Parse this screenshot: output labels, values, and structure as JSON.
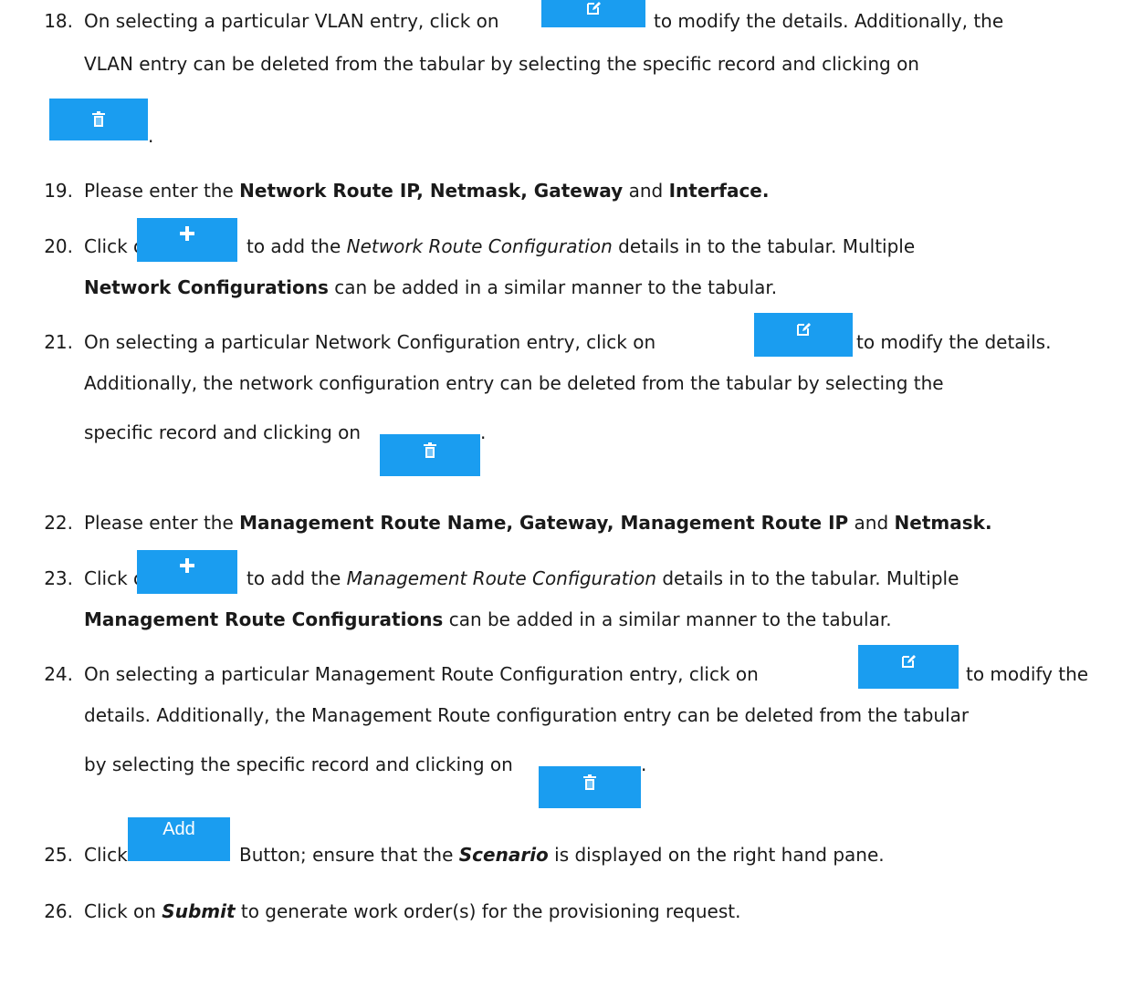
{
  "steps": [
    {
      "number": "18.",
      "t1": "On selecting a particular VLAN entry, click on",
      "t2": "to modify the details. Additionally, the",
      "t3": "VLAN entry can be deleted from the tabular by selecting the specific record and clicking on",
      "t4": "."
    },
    {
      "number": "19.",
      "t1": "Please enter the",
      "b1": "Network Route IP, Netmask, Gateway",
      "t2": "and",
      "b2": "Interface."
    },
    {
      "number": "20.",
      "t1": "Click on",
      "t2": "to add the",
      "i1": "Network Route Configuration",
      "t3": "details in to the tabular. Multiple",
      "b1": "Network Configurations",
      "t4": "can be added in a similar manner to the tabular."
    },
    {
      "number": "21.",
      "t1": "On selecting a particular Network Configuration entry, click on",
      "t2": "to modify the details.",
      "t3": "Additionally, the network configuration entry can be deleted from the tabular by selecting the",
      "t4": "specific record and clicking on",
      "t5": "."
    },
    {
      "number": "22.",
      "t1": "Please enter the",
      "b1": "Management Route Name, Gateway, Management Route IP",
      "t2": "and",
      "b2": "Netmask."
    },
    {
      "number": "23.",
      "t1": "Click on",
      "t2": "to add the",
      "i1": "Management Route Configuration",
      "t3": "details in to the tabular. Multiple",
      "b1": "Management Route Configurations",
      "t4": "can be added in a similar manner to the tabular."
    },
    {
      "number": "24.",
      "t1": "On selecting a particular Management Route Configuration entry, click on",
      "t2": "to modify the",
      "t3": "details. Additionally, the Management Route configuration entry can be deleted from the tabular",
      "t4": "by selecting the specific record and clicking on",
      "t5": "."
    },
    {
      "number": "25.",
      "t1": "Click",
      "button": "Add",
      "t2": "Button; ensure that the",
      "bi1": "Scenario",
      "t3": "is displayed on the right hand pane."
    },
    {
      "number": "26.",
      "t1": "Click on",
      "bi1": "Submit",
      "t2": "to generate work order(s) for the provisioning request."
    }
  ],
  "icons": {
    "edit": "edit-icon",
    "delete": "trash-icon",
    "add": "plus-icon"
  },
  "colors": {
    "button_bg": "#1a9df0",
    "text": "#1a1a1a"
  }
}
